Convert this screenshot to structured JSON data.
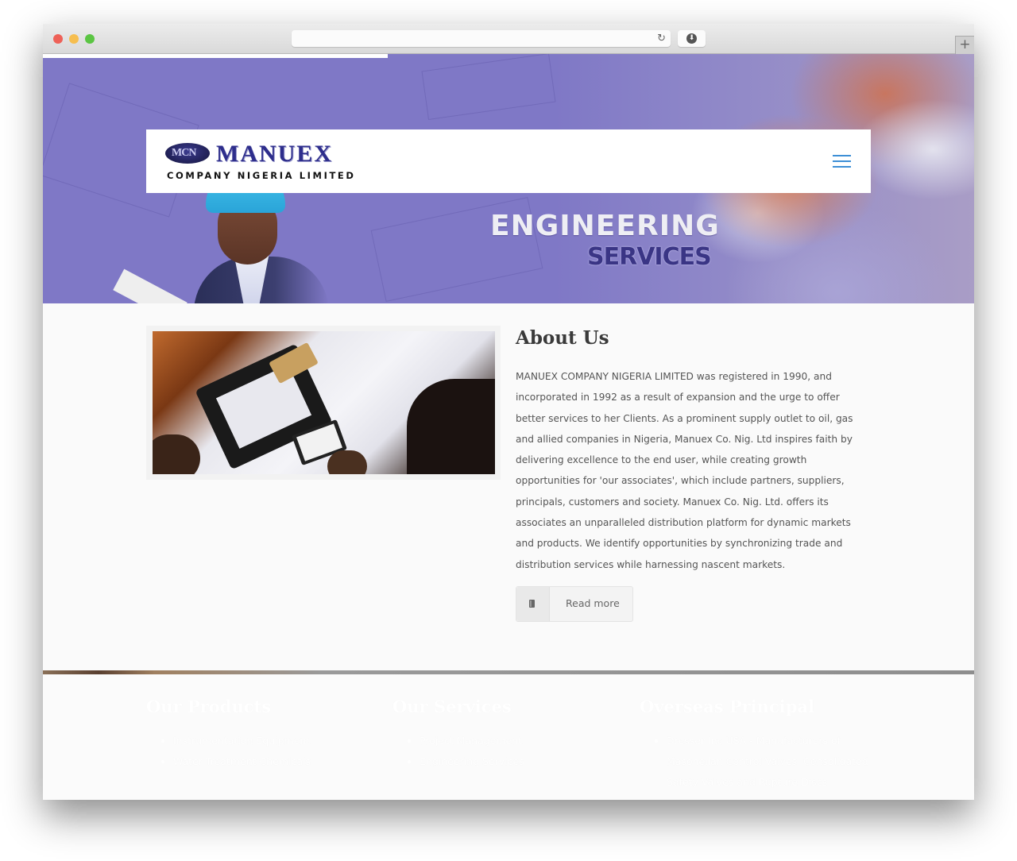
{
  "browser": {
    "url": "",
    "reload_icon": "↻",
    "download_icon": "⬇",
    "new_tab_icon": "+",
    "load_progress": 0.37
  },
  "header": {
    "logo": {
      "emblem_text": "MCN",
      "wordmark": "MANUEX",
      "subtitle": "COMPANY NIGERIA LIMITED"
    },
    "menu_icon": "hamburger-menu"
  },
  "hero": {
    "slogan_line1": "ENGINEERING",
    "slogan_line2": "SERVICES"
  },
  "about": {
    "title": "About Us",
    "text": "MANUEX COMPANY NIGERIA LIMITED was registered in 1990, and incorporated in 1992 as a result of expansion and the urge to offer better services to her Clients. As a prominent supply outlet to oil, gas and allied companies in Nigeria, Manuex Co. Nig. Ltd inspires faith by delivering excellence to the end user, while creating growth opportunities for 'our associates', which include partners, suppliers, principals, customers and society. Manuex Co. Nig. Ltd. offers its associates an unparalleled distribution platform for dynamic markets and products. We identify opportunities by synchronizing trade and distribution services while harnessing nascent markets.",
    "read_more_label": "Read more",
    "read_more_icon": "book"
  },
  "footer": {
    "columns": [
      {
        "title": "Our Products",
        "items": [
          "Instrumentation Equipment",
          "Water Treatment Chemicals"
        ]
      },
      {
        "title": "Our Services",
        "items": [
          "Project Management",
          "Engineering Services"
        ]
      },
      {
        "title": "Overseas Principal",
        "items": [
          "Dresser Inc USA - Manufacturers of Masoneilan Control Valves, Consolidated Safety Valves and Rupture Discs"
        ]
      }
    ]
  },
  "colors": {
    "hero_purple": "#7f78c6",
    "menu_blue": "#3d8fd6",
    "heading": "#3a3a3a",
    "body_text": "#555555"
  }
}
